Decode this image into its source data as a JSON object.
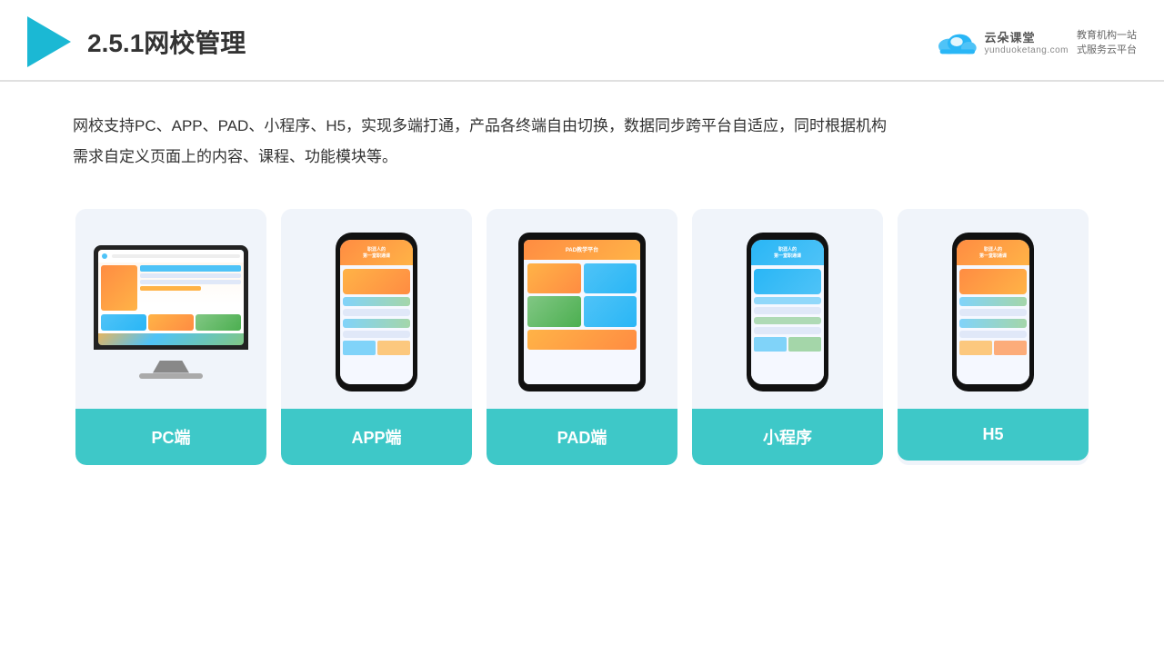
{
  "header": {
    "title": "2.5.1网校管理",
    "brand_name": "云朵课堂",
    "brand_url": "yunduoketang.com",
    "brand_tagline1": "教育机构一站",
    "brand_tagline2": "式服务云平台"
  },
  "description": {
    "text": "网校支持PC、APP、PAD、小程序、H5，实现多端打通，产品各终端自由切换，数据同步跨平台自适应，同时根据机构需求自定义页面上的内容、课程、功能模块等。"
  },
  "cards": [
    {
      "id": "pc",
      "label": "PC端"
    },
    {
      "id": "app",
      "label": "APP端"
    },
    {
      "id": "pad",
      "label": "PAD端"
    },
    {
      "id": "miniapp",
      "label": "小程序"
    },
    {
      "id": "h5",
      "label": "H5"
    }
  ]
}
